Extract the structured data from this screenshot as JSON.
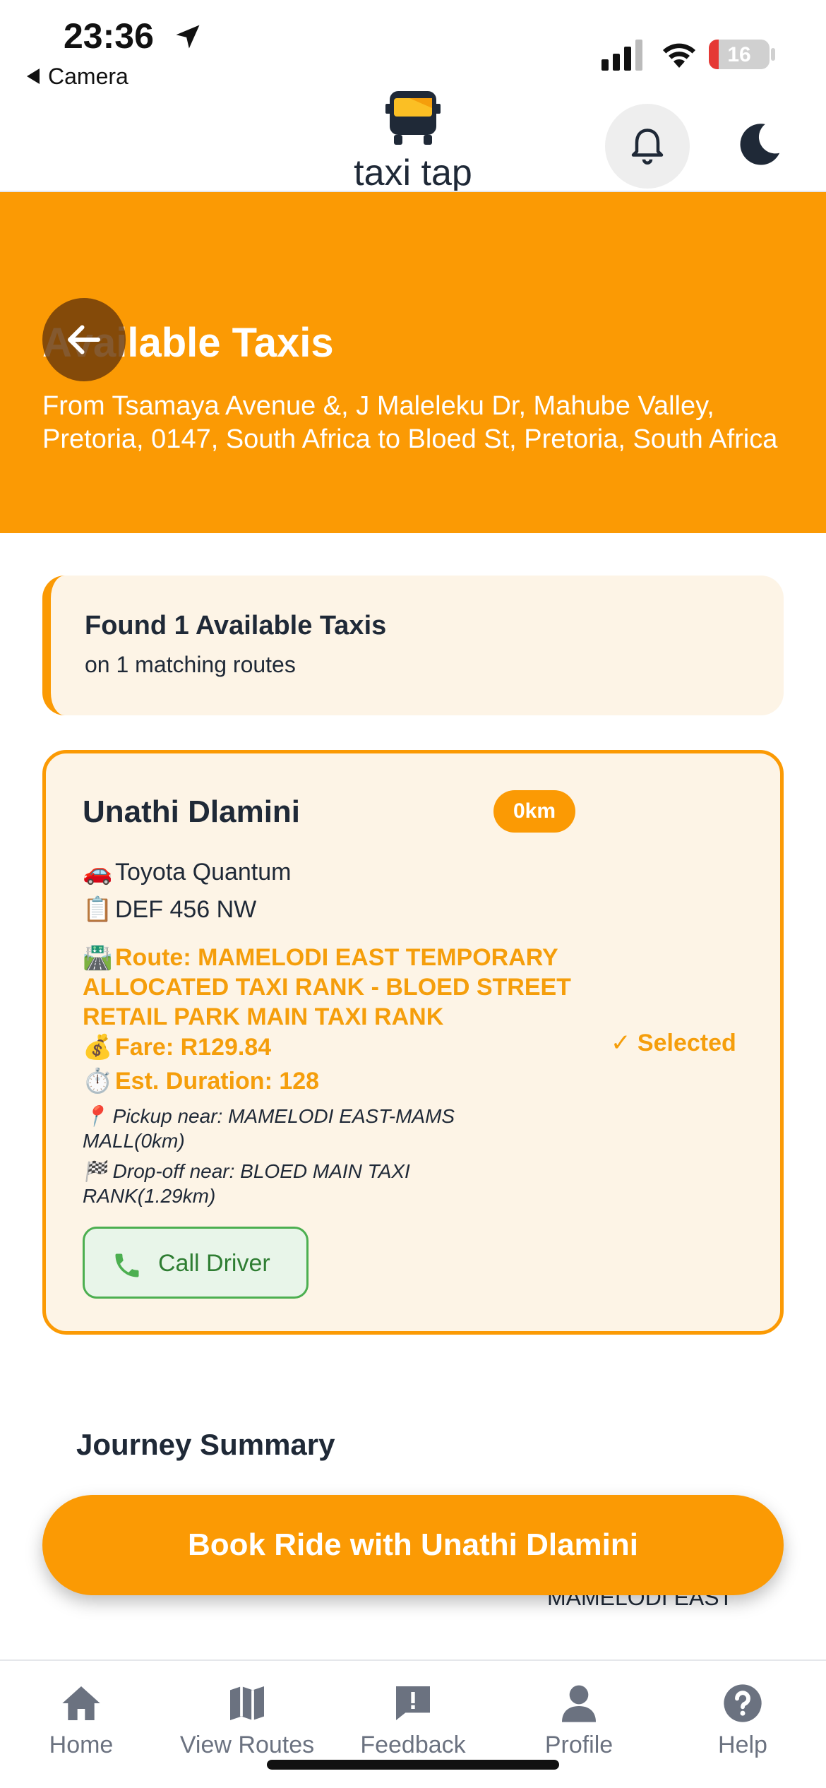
{
  "status_bar": {
    "time": "23:36",
    "back_app": "Camera",
    "battery": "16"
  },
  "header": {
    "logo_text": "taxi tap",
    "icons": [
      "taxi-logo-icon",
      "bell-icon",
      "moon-icon"
    ]
  },
  "hero": {
    "title": "Available Taxis",
    "subtitle": "From Tsamaya Avenue &, J Maleleku Dr, Mahube Valley, Pretoria, 0147, South Africa to Bloed St, Pretoria, South Africa"
  },
  "found": {
    "title": "Found 1 Available Taxis",
    "subtitle": "on 1 matching routes"
  },
  "taxi": {
    "driver_name": "Unathi Dlamini",
    "distance_badge": "0km",
    "vehicle_emoji": "🚗",
    "vehicle": "Toyota Quantum",
    "plate_emoji": "📋",
    "plate": "DEF 456 NW",
    "route_emoji": "🛣️",
    "route": "Route: MAMELODI EAST TEMPORARY ALLOCATED TAXI RANK - BLOED STREET RETAIL PARK MAIN TAXI RANK",
    "fare_emoji": "💰",
    "fare": "Fare: R129.84",
    "duration_emoji": "⏱️",
    "duration": "Est. Duration: 128",
    "pickup_emoji": "📍",
    "pickup": "Pickup near: MAMELODI EAST-MAMS MALL(0km)",
    "dropoff_emoji": "🏁",
    "dropoff": "Drop-off near: BLOED MAIN TAXI RANK(1.29km)",
    "selected_label": "✓ Selected",
    "call_label": "Call Driver"
  },
  "journey": {
    "title": "Journey Summary",
    "peek_text": "MAMELODI EAST"
  },
  "book_button": "Book Ride with Unathi Dlamini",
  "nav": {
    "items": [
      {
        "label": "Home",
        "icon": "home-icon"
      },
      {
        "label": "View Routes",
        "icon": "map-icon"
      },
      {
        "label": "Feedback",
        "icon": "feedback-icon"
      },
      {
        "label": "Profile",
        "icon": "profile-icon"
      },
      {
        "label": "Help",
        "icon": "help-icon"
      }
    ]
  },
  "colors": {
    "accent": "#fb9a04",
    "accent_text": "#f59e0b",
    "card_bg": "#fdf4e6",
    "success": "#4caf50"
  }
}
